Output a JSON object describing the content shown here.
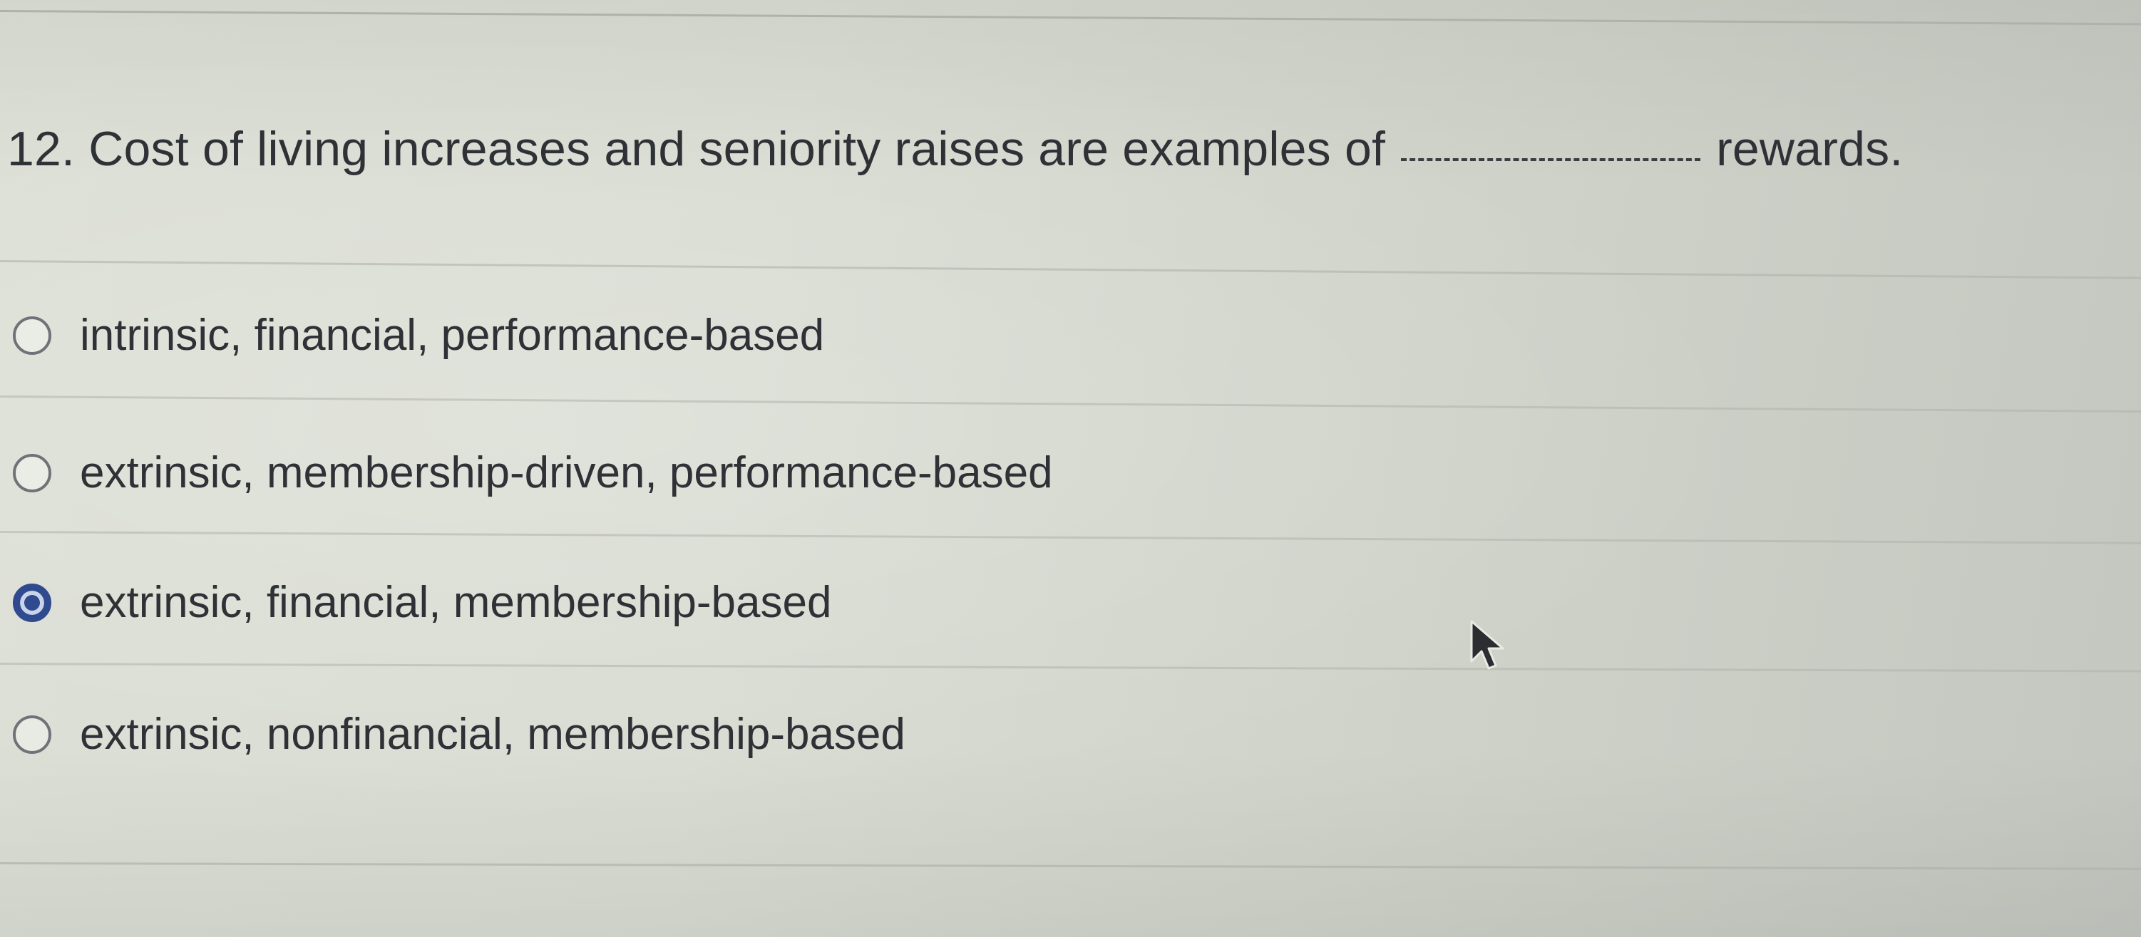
{
  "question": {
    "number": "12.",
    "text_before": "Cost of living increases and seniority raises are examples of",
    "text_after": "rewards."
  },
  "options": [
    {
      "label": "intrinsic, financial, performance-based",
      "selected": false
    },
    {
      "label": "extrinsic, membership-driven, performance-based",
      "selected": false
    },
    {
      "label": "extrinsic, financial, membership-based",
      "selected": true
    },
    {
      "label": "extrinsic, nonfinancial, membership-based",
      "selected": false
    }
  ],
  "colors": {
    "accent": "#2f4a8e",
    "text": "#2e3236",
    "radio_border": "#6f7378"
  },
  "icons": {
    "cursor": "mouse-pointer-icon"
  }
}
